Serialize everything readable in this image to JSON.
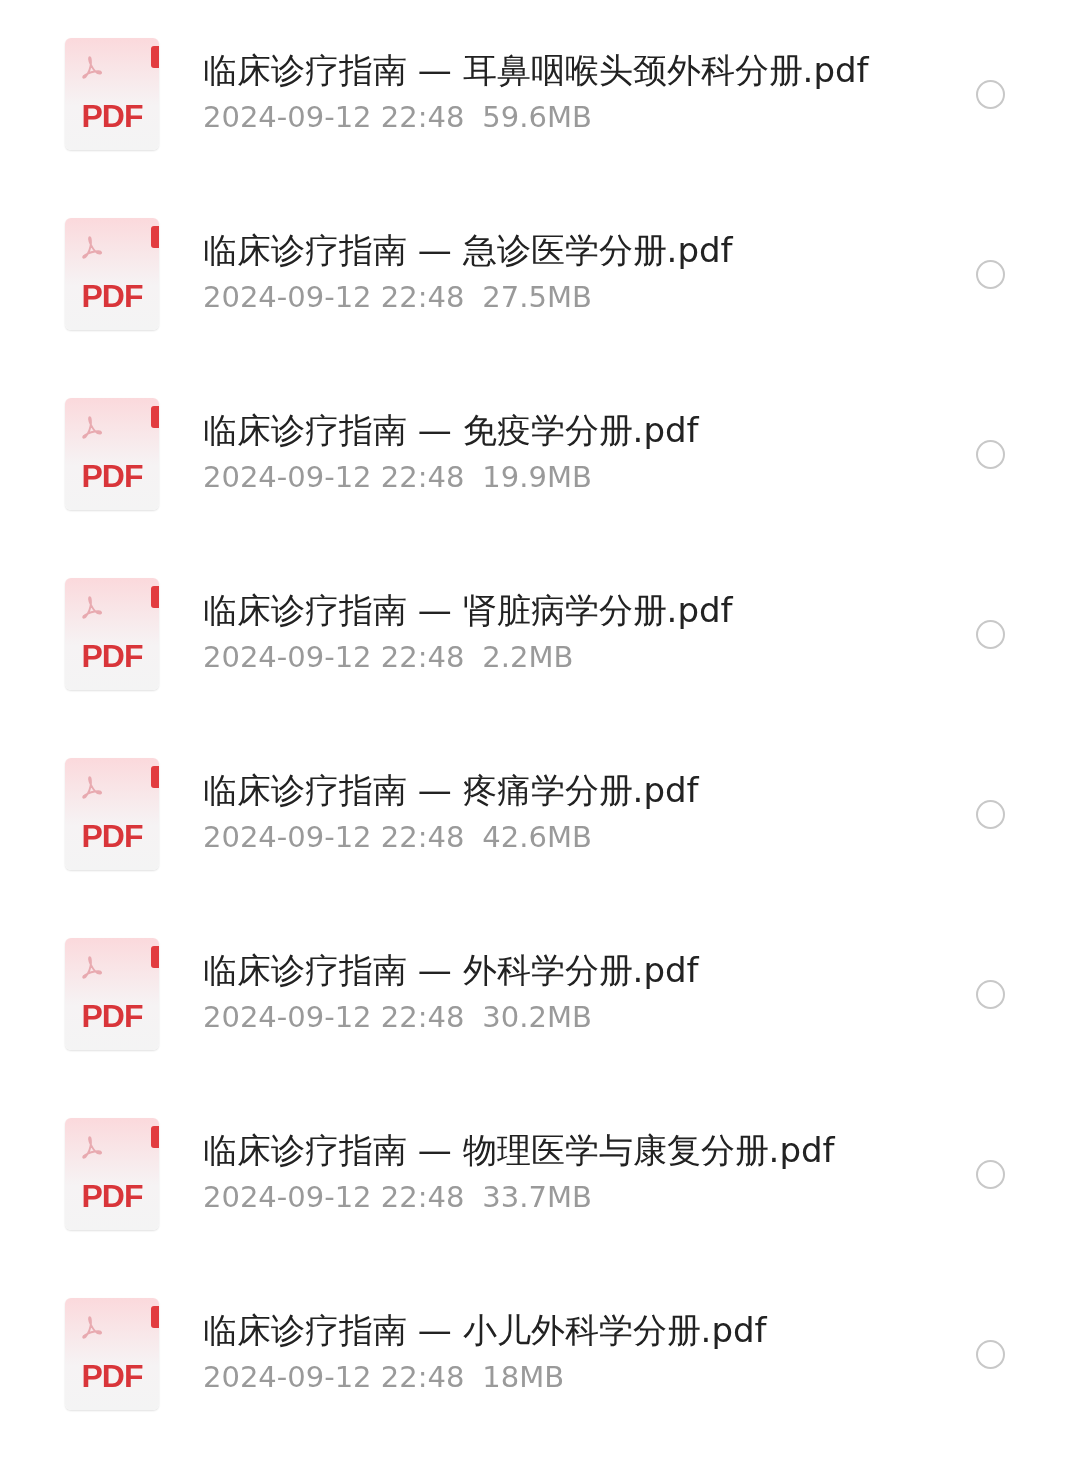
{
  "files": [
    {
      "name": "临床诊疗指南 — 耳鼻咽喉头颈外科分册.pdf",
      "date": "2024-09-12 22:48",
      "size": "59.6MB",
      "icon_label": "PDF",
      "selected": false
    },
    {
      "name": "临床诊疗指南 — 急诊医学分册.pdf",
      "date": "2024-09-12 22:48",
      "size": "27.5MB",
      "icon_label": "PDF",
      "selected": false
    },
    {
      "name": "临床诊疗指南 — 免疫学分册.pdf",
      "date": "2024-09-12 22:48",
      "size": "19.9MB",
      "icon_label": "PDF",
      "selected": false
    },
    {
      "name": "临床诊疗指南 — 肾脏病学分册.pdf",
      "date": "2024-09-12 22:48",
      "size": "2.2MB",
      "icon_label": "PDF",
      "selected": false
    },
    {
      "name": "临床诊疗指南 — 疼痛学分册.pdf",
      "date": "2024-09-12 22:48",
      "size": "42.6MB",
      "icon_label": "PDF",
      "selected": false
    },
    {
      "name": "临床诊疗指南 — 外科学分册.pdf",
      "date": "2024-09-12 22:48",
      "size": "30.2MB",
      "icon_label": "PDF",
      "selected": false
    },
    {
      "name": "临床诊疗指南 — 物理医学与康复分册.pdf",
      "date": "2024-09-12 22:48",
      "size": "33.7MB",
      "icon_label": "PDF",
      "selected": false
    },
    {
      "name": "临床诊疗指南 — 小儿外科学分册.pdf",
      "date": "2024-09-12 22:48",
      "size": "18MB",
      "icon_label": "PDF",
      "selected": false
    }
  ]
}
